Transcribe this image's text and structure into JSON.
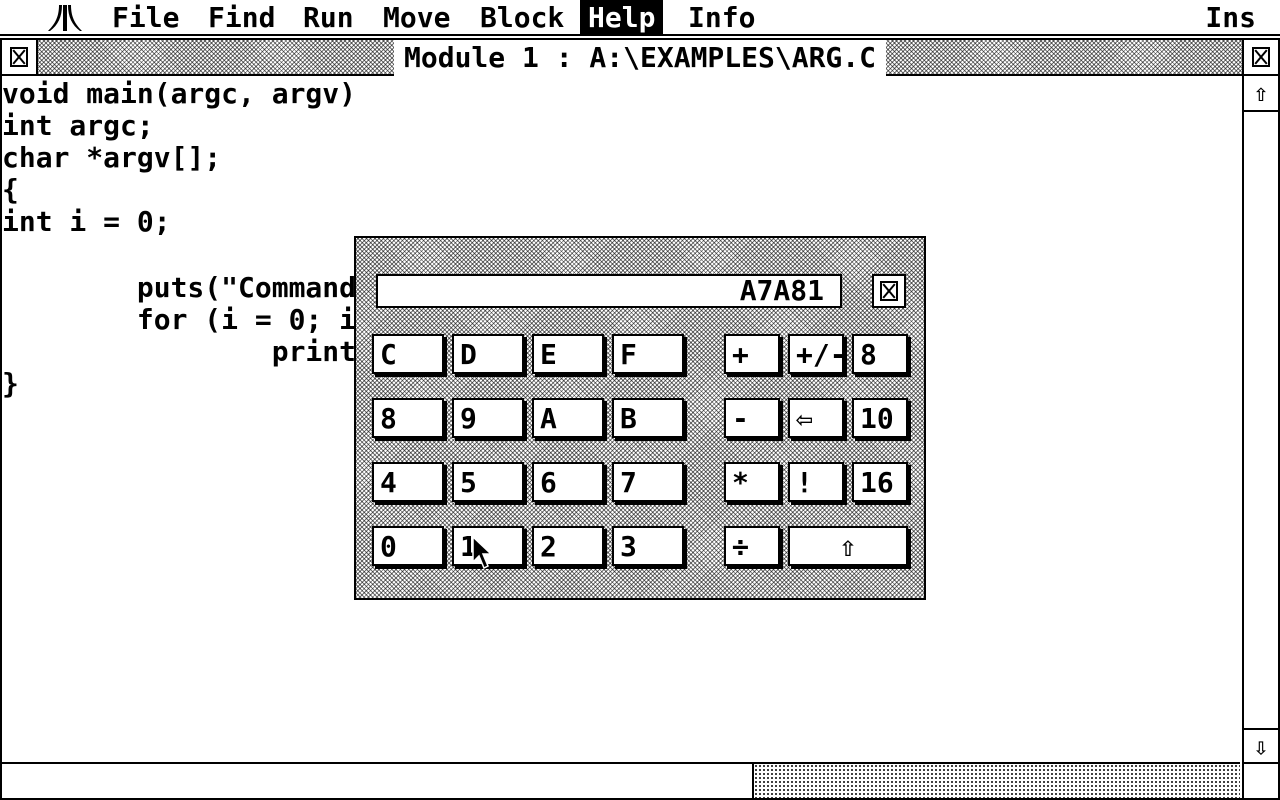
{
  "menubar": {
    "items": [
      {
        "label": "File"
      },
      {
        "label": "Find"
      },
      {
        "label": "Run"
      },
      {
        "label": "Move"
      },
      {
        "label": "Block"
      },
      {
        "label": "Help"
      },
      {
        "label": "Info"
      }
    ],
    "active_item": "Help",
    "mode_indicator": "Ins"
  },
  "window": {
    "title": "Module 1 : A:\\EXAMPLES\\ARG.C"
  },
  "editor": {
    "lines": [
      "void main(argc, argv)",
      "int argc;",
      "char *argv[];",
      "{",
      "int i = 0;",
      "",
      "        puts(\"Command",
      "        for (i = 0; i",
      "                printf",
      "}"
    ]
  },
  "calculator": {
    "display": "A7A81",
    "keys": [
      {
        "label": "C"
      },
      {
        "label": "D"
      },
      {
        "label": "E"
      },
      {
        "label": "F"
      },
      {
        "label": "+"
      },
      {
        "label": "+/-"
      },
      {
        "label": "8"
      },
      {
        "label": "8"
      },
      {
        "label": "9"
      },
      {
        "label": "A"
      },
      {
        "label": "B"
      },
      {
        "label": "-"
      },
      {
        "label": "⇦"
      },
      {
        "label": "10"
      },
      {
        "label": "4"
      },
      {
        "label": "5"
      },
      {
        "label": "6"
      },
      {
        "label": "7"
      },
      {
        "label": "*"
      },
      {
        "label": "!"
      },
      {
        "label": "16"
      },
      {
        "label": "0"
      },
      {
        "label": "1"
      },
      {
        "label": "2"
      },
      {
        "label": "3"
      },
      {
        "label": "÷"
      },
      {
        "label": "⇧"
      }
    ]
  },
  "scrollbar": {
    "up_arrow": "⇧",
    "down_arrow": "⇩"
  },
  "icons": {
    "logo": "atari-logo-icon",
    "close": "close-box-icon",
    "full": "full-box-icon",
    "cursor": "mouse-pointer-icon"
  }
}
